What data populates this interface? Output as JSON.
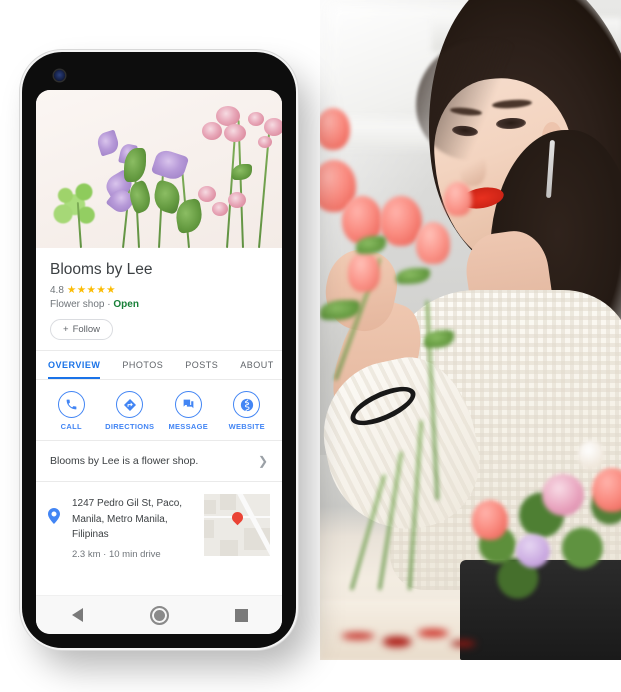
{
  "photo": {
    "description": "Woman in white knit sweater arranging pink roses in a florist shop",
    "alt_label": "florist-photo"
  },
  "phone": {
    "camera_label": "front-camera",
    "hero": {
      "label": "flower flat-lay header image",
      "background_color": "#f7f0ec"
    },
    "business": {
      "name": "Blooms by Lee",
      "rating": "4.8",
      "stars": "★★★★★",
      "star_color": "#fbbc04",
      "category": "Flower shop",
      "separator": "·",
      "status": "Open",
      "status_color": "#188038",
      "follow_label": "Follow",
      "follow_plus": "+"
    },
    "tabs": [
      {
        "label": "OVERVIEW",
        "active": true
      },
      {
        "label": "PHOTOS",
        "active": false
      },
      {
        "label": "POSTS",
        "active": false
      },
      {
        "label": "ABOUT",
        "active": false
      }
    ],
    "accent_color": "#1a73e8",
    "actions": [
      {
        "label": "CALL",
        "icon": "phone-icon"
      },
      {
        "label": "DIRECTIONS",
        "icon": "directions-icon"
      },
      {
        "label": "MESSAGE",
        "icon": "message-icon"
      },
      {
        "label": "WEBSITE",
        "icon": "globe-icon"
      }
    ],
    "description": {
      "text": "Blooms by Lee is a flower shop.",
      "chevron": "❯"
    },
    "address": {
      "line1": "1247 Pedro Gil St, Paco,",
      "line2": "Manila, Metro Manila,",
      "line3": "Filipinas",
      "distance": "2.3 km",
      "separator": "·",
      "drive_time": "10 min drive",
      "pin_color": "#4285f4",
      "map_pin_color": "#ea4335"
    },
    "navbar": {
      "back_label": "back",
      "home_label": "home",
      "recents_label": "recents"
    }
  }
}
